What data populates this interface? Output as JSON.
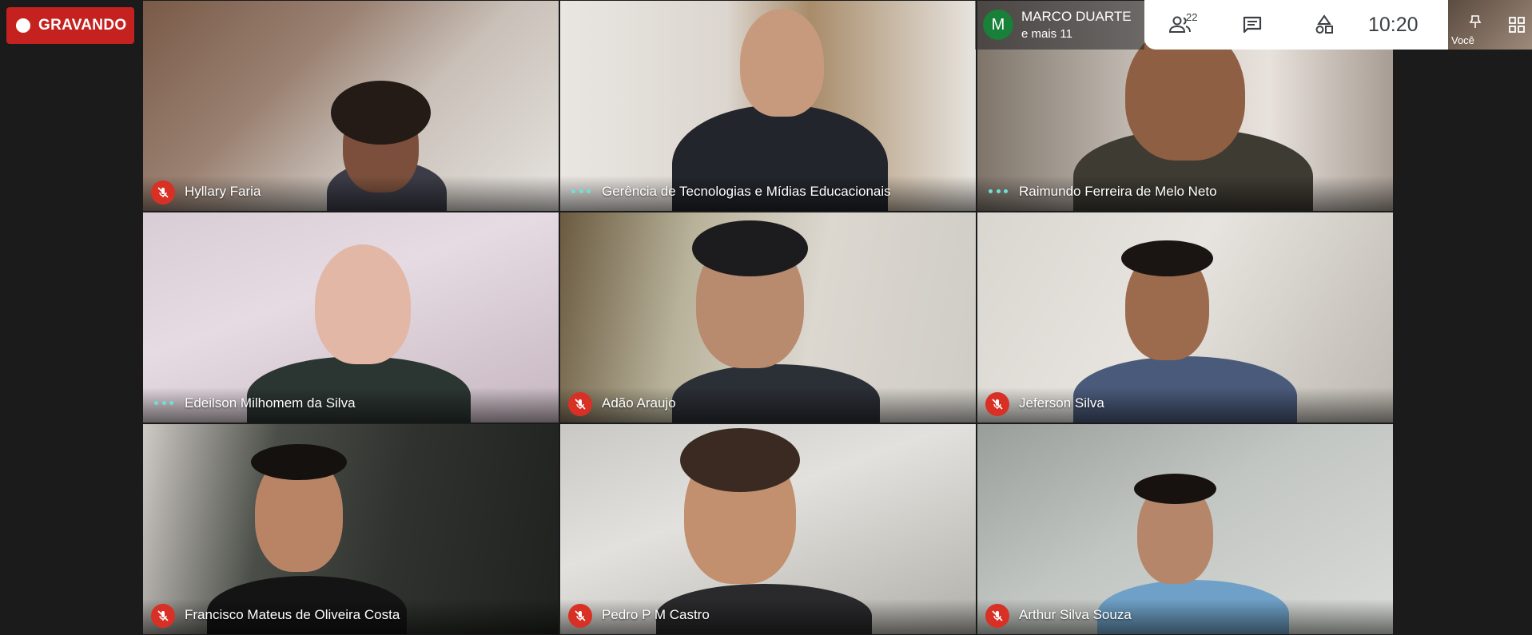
{
  "recording": {
    "label": "GRAVANDO"
  },
  "presenter": {
    "avatar_initial": "M",
    "name": "MARCO DUARTE",
    "others": "e mais 11"
  },
  "toolbar": {
    "participants_count": "22",
    "time": "10:20"
  },
  "self_view": {
    "label": "Você"
  },
  "colors": {
    "recording": "#c5221f",
    "mic_off": "#d93025",
    "speaking_dots": "#6ee0d8",
    "avatar": "#188038"
  },
  "participants": [
    {
      "name": "Hyllary Faria",
      "status": "muted"
    },
    {
      "name": "Gerência de Tecnologias e Mídias Educacionais",
      "status": "active"
    },
    {
      "name": "Raimundo Ferreira de Melo Neto",
      "status": "active"
    },
    {
      "name": "Edeilson Milhomem da Silva",
      "status": "active"
    },
    {
      "name": "Adão Araujo",
      "status": "muted"
    },
    {
      "name": "Jeferson Silva",
      "status": "muted"
    },
    {
      "name": "Francisco Mateus de Oliveira Costa",
      "status": "muted"
    },
    {
      "name": "Pedro P M Castro",
      "status": "muted"
    },
    {
      "name": "Arthur Silva Souza",
      "status": "muted"
    }
  ]
}
